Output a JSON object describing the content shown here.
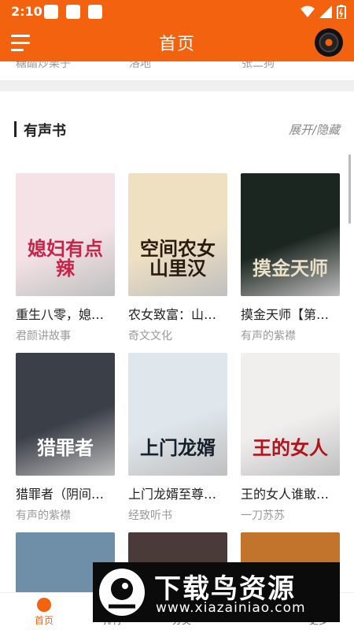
{
  "status": {
    "time": "2:10"
  },
  "header": {
    "title": "首页"
  },
  "previous_row": [
    "糖醋炒栗子",
    "洛地",
    "张二狗"
  ],
  "section": {
    "title": "有声书",
    "toggle": "展开/隐藏"
  },
  "books": [
    {
      "name": "重生八零，媳…",
      "author": "君颜讲故事",
      "cover_text": "媳妇有点辣",
      "cover_bg": "#f4e2e6",
      "cover_fg": "#c8244a"
    },
    {
      "name": "农女致富：山…",
      "author": "奇文文化",
      "cover_text": "空间农女山里汉",
      "cover_bg": "#efe0c2",
      "cover_fg": "#2a1a10"
    },
    {
      "name": "摸金天师【第…",
      "author": "有声的紫襟",
      "cover_text": "摸金天师",
      "cover_bg": "#1c2620",
      "cover_fg": "#e8e0c8"
    },
    {
      "name": "猎罪者（阴间…",
      "author": "有声的紫襟",
      "cover_text": "猎罪者",
      "cover_bg": "#3b3f48",
      "cover_fg": "#ffffff"
    },
    {
      "name": "上门龙婿至尊…",
      "author": "经致听书",
      "cover_text": "上门龙婿",
      "cover_bg": "#dfe6ec",
      "cover_fg": "#15202a"
    },
    {
      "name": "王的女人谁敢…",
      "author": "一刀苏苏",
      "cover_text": "王的女人",
      "cover_bg": "#f1eeee",
      "cover_fg": "#b0151c"
    },
    {
      "name": "",
      "author": "",
      "cover_text": "",
      "cover_bg": "#6f8ea8",
      "cover_fg": "#ffffff"
    },
    {
      "name": "",
      "author": "",
      "cover_text": "",
      "cover_bg": "#4a3a3a",
      "cover_fg": "#ffffff"
    },
    {
      "name": "",
      "author": "",
      "cover_text": "",
      "cover_bg": "#c3742c",
      "cover_fg": "#ffffff"
    }
  ],
  "tabs": [
    {
      "label": "首页",
      "active": true
    },
    {
      "label": "排行",
      "active": false
    },
    {
      "label": "分类",
      "active": false
    },
    {
      "label": "",
      "active": false
    },
    {
      "label": "更多",
      "active": false
    }
  ],
  "watermark": {
    "main": "下载鸟资源",
    "url": "www.xiazainiao.com"
  },
  "colors": {
    "accent": "#f2620f",
    "text": "#222222",
    "muted": "#999999"
  }
}
